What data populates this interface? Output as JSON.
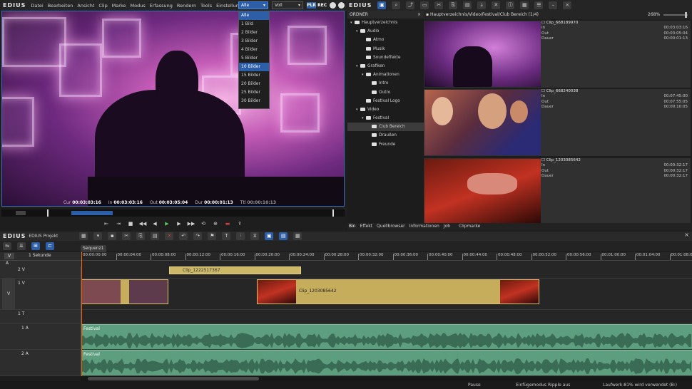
{
  "app": {
    "logo": "EDIUS",
    "project_label": "EDIUS Projekt"
  },
  "menu": {
    "items": [
      "Datei",
      "Bearbeiten",
      "Ansicht",
      "Clip",
      "Marke",
      "Modus",
      "Erfassung",
      "Rendern",
      "Tools",
      "Einstellungen"
    ]
  },
  "player": {
    "frame_select": "Alle",
    "quality_select": "Voll",
    "plr_label": "PLR",
    "rec_label": "REC",
    "dropdown_options": [
      "Alle",
      "1 Bild",
      "2 Bilder",
      "3 Bilder",
      "4 Bilder",
      "5 Bilder",
      "10 Bilder",
      "15 Bilder",
      "20 Bilder",
      "25 Bilder",
      "30 Bilder"
    ],
    "dropdown_selected": "10 Bilder",
    "timecodes": {
      "cur_label": "Cur",
      "cur": "00:03:03:16",
      "in_label": "In",
      "in": "00:03:03:16",
      "out_label": "Out",
      "out": "00:03:05:04",
      "dur_label": "Dur",
      "dur": "00:00:01:13",
      "ttl_label": "Ttl",
      "ttl": "00:00:10:13"
    }
  },
  "folders": {
    "header": "ORDNER",
    "items": [
      {
        "label": "Hauptverzeichnis",
        "depth": 0,
        "expanded": true
      },
      {
        "label": "Audio",
        "depth": 1,
        "expanded": true
      },
      {
        "label": "Atmo",
        "depth": 2
      },
      {
        "label": "Musik",
        "depth": 2
      },
      {
        "label": "Soundeffekte",
        "depth": 2
      },
      {
        "label": "Grafiken",
        "depth": 1,
        "expanded": true
      },
      {
        "label": "Animationen",
        "depth": 2,
        "expanded": true
      },
      {
        "label": "Intro",
        "depth": 3
      },
      {
        "label": "Outro",
        "depth": 3
      },
      {
        "label": "Festival Logo",
        "depth": 2
      },
      {
        "label": "Video",
        "depth": 1,
        "expanded": true
      },
      {
        "label": "Festival",
        "depth": 2,
        "expanded": true
      },
      {
        "label": "Club Bereich",
        "depth": 3,
        "selected": true
      },
      {
        "label": "Draußen",
        "depth": 3
      },
      {
        "label": "Freunde",
        "depth": 3
      }
    ]
  },
  "bin": {
    "path": "Hauptverzeichnis/Video/Festival/Club Bereich (1/4)",
    "zoom": "268%",
    "clips": [
      {
        "name": "Clip_668189970",
        "in_label": "In",
        "in": "00:03:03:16",
        "out_label": "Out",
        "out": "00:03:05:04",
        "dur_label": "Dauer",
        "dur": "00:00:01:13"
      },
      {
        "name": "Clip_668240038",
        "in_label": "In",
        "in": "00:07:45:00",
        "out_label": "Out",
        "out": "00:07:55:05",
        "dur_label": "Dauer",
        "dur": "00:00:10:05"
      },
      {
        "name": "Clip_1203085642",
        "in_label": "In",
        "in": "00:00:32:17",
        "out_label": "Out",
        "out": "00:00:32:17",
        "dur_label": "Dauer",
        "dur": "00:00:32:17"
      }
    ],
    "tabs": [
      "Bin",
      "Effekt",
      "Quellbrowser",
      "Informationen",
      "Job",
      "Clipmarke"
    ]
  },
  "timeline": {
    "sequence_tab": "Sequenz1",
    "scale": "1 Sekunde",
    "ruler": [
      "00:00:00:00",
      "00:00:04:00",
      "00:00:08:00",
      "00:00:12:00",
      "00:00:16:00",
      "00:00:20:00",
      "00:00:24:00",
      "00:00:28:00",
      "00:00:32:00",
      "00:00:36:00",
      "00:00:40:00",
      "00:00:44:00",
      "00:00:48:00",
      "00:00:52:00",
      "00:00:56:00",
      "00:01:00:00",
      "00:01:04:00",
      "00:01:08:00"
    ],
    "tracks": {
      "v2": "2 V",
      "v1": "1 V",
      "t1": "1 T",
      "a1": "1 A",
      "a2": "2 A",
      "v_main": "V",
      "a_main": "A"
    },
    "clips": {
      "title_clip": "Clip_1222517367",
      "video_clip": "Clip_1203085642",
      "audio1": "Festival",
      "audio2": "Festival"
    }
  },
  "status": {
    "pause": "Pause",
    "mode": "Einfügemodus",
    "ripple": "Ripple aus",
    "drive": "Laufwerk:81% wird verwendet (B:)"
  }
}
